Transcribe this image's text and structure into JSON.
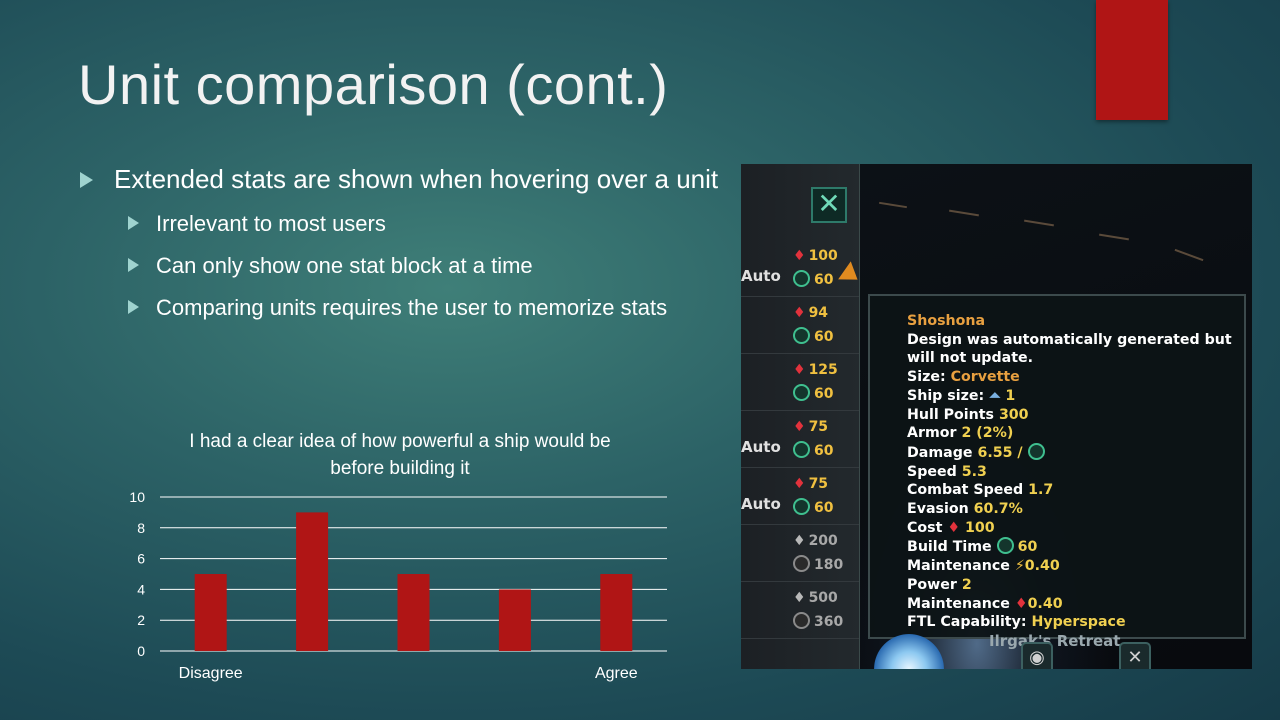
{
  "slide": {
    "title": "Unit comparison (cont.)",
    "accent_color": "#b01515"
  },
  "bullets": {
    "main": "Extended stats are shown when hovering over a unit",
    "sub": [
      "Irrelevant to most users",
      "Can only show one stat block at a time",
      "Comparing units requires the user to memorize stats"
    ]
  },
  "chart_data": {
    "type": "bar",
    "title": "I had a clear idea of how powerful a ship would be before building it",
    "categories": [
      "Disagree",
      "",
      "",
      "",
      "Agree"
    ],
    "values": [
      5,
      9,
      5,
      4,
      5
    ],
    "ylim": [
      0,
      10
    ],
    "yticks": [
      0,
      2,
      4,
      6,
      8,
      10
    ],
    "grid": true,
    "bar_color": "#b01515"
  },
  "game": {
    "close_glyph": "✕",
    "rows": [
      {
        "auto": "Auto",
        "cost": "100",
        "time": "60",
        "dim": false
      },
      {
        "auto": "",
        "cost": "94",
        "time": "60",
        "dim": false
      },
      {
        "auto": "",
        "cost": "125",
        "time": "60",
        "dim": false
      },
      {
        "auto": "Auto",
        "cost": "75",
        "time": "60",
        "dim": false
      },
      {
        "auto": "Auto",
        "cost": "75",
        "time": "60",
        "dim": false
      },
      {
        "auto": "",
        "cost": "200",
        "time": "180",
        "dim": true
      },
      {
        "auto": "",
        "cost": "500",
        "time": "360",
        "dim": true
      }
    ],
    "tooltip": {
      "name": "Shoshona",
      "desc1": "Design was automatically generated but",
      "desc2": "will not update.",
      "size_label": "Size:",
      "size_value": "Corvette",
      "ship_size_label": "Ship size:",
      "ship_size_value": "1",
      "hull_label": "Hull Points",
      "hull_value": "300",
      "armor_label": "Armor",
      "armor_value": "2 (2%)",
      "damage_label": "Damage",
      "damage_value": "6.55 /",
      "speed_label": "Speed",
      "speed_value": "5.3",
      "combat_speed_label": "Combat Speed",
      "combat_speed_value": "1.7",
      "evasion_label": "Evasion",
      "evasion_value": "60.7%",
      "cost_label": "Cost",
      "cost_value": "100",
      "build_time_label": "Build Time",
      "build_time_value": "60",
      "maint1_label": "Maintenance",
      "maint1_value": "0.40",
      "power_label": "Power",
      "power_value": "2",
      "maint2_label": "Maintenance",
      "maint2_value": "0.40",
      "ftl_label": "FTL Capability:",
      "ftl_value": "Hyperspace"
    },
    "planet_name": "Ilrgak's Retreat"
  }
}
